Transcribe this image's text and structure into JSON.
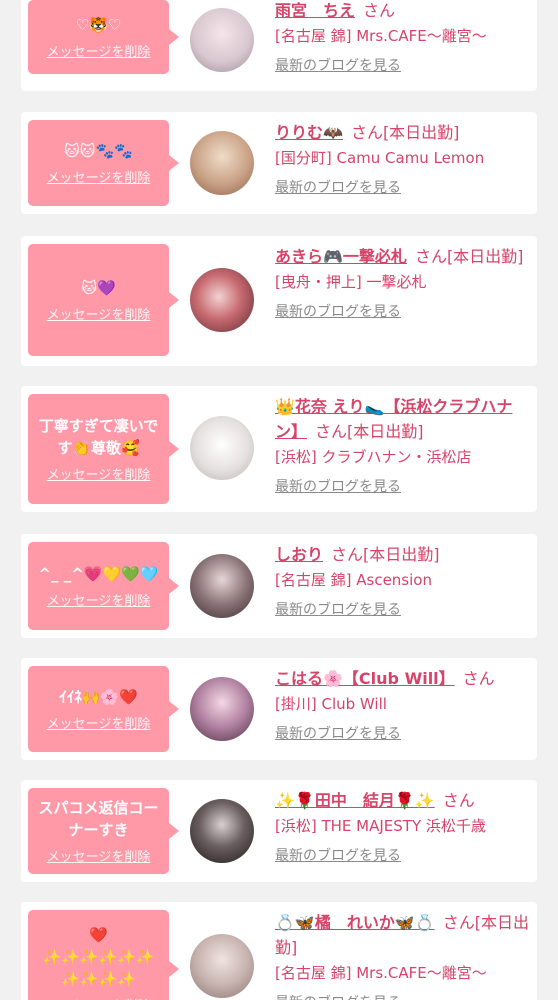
{
  "common": {
    "delete_label": "メッセージを削除",
    "blog_link": "最新のブログを見る",
    "san": "さん"
  },
  "colors": {
    "bubble": "#ff99a8",
    "accent": "#d8436a",
    "link_gray": "#8a8a8a",
    "background": "#f1f1f1"
  },
  "cards": [
    {
      "message": "♡🐯♡",
      "name": "雨宮　ちえ",
      "name_suffix": "さん",
      "shop": "[名古屋 錦] Mrs.CAFE〜離宮〜",
      "avatar_color": "#d9c8cf"
    },
    {
      "message": "🐱🐱🐾🐾",
      "name": "りりむ🦇",
      "name_suffix": "さん[本日出勤]",
      "shop": "[国分町] Camu Camu Lemon",
      "avatar_color": "#c9a185"
    },
    {
      "message": "🐱💜",
      "name": "あきら🎮一撃必札",
      "name_suffix": "さん[本日出勤]",
      "shop": "[曳舟・押上] 一撃必札",
      "avatar_color": "#8a4a50"
    },
    {
      "message": "丁寧すぎて凄いで\nす👏尊敬🥰",
      "name": "👑花奈 えり🥿【浜松クラブハナン】",
      "name_suffix": "さん[本日出勤]",
      "shop": "[浜松] クラブハナン・浜松店",
      "avatar_color": "#e4e0de"
    },
    {
      "message": "^_ _^💗💛💚🩵",
      "name": "しおり",
      "name_suffix": "さん[本日出勤]",
      "shop": "[名古屋 錦] Ascension",
      "avatar_color": "#5a4a4e"
    },
    {
      "message": "ｲｲﾈ🙌🌸❤️",
      "name": "こはる🌸【Club Will】",
      "name_suffix": "さん",
      "shop": "[掛川] Club Will",
      "avatar_color": "#7a5a68"
    },
    {
      "message": "スパコメ返信コー\nナーすき",
      "name": "✨🌹田中　結月🌹✨",
      "name_suffix": "さん",
      "shop": "[浜松] THE MAJESTY 浜松千歳",
      "avatar_color": "#3a3436"
    },
    {
      "message": "❤️\n✨✨✨✨✨✨\n✨✨✨✨",
      "name": "💍🦋橘　れいか🦋💍",
      "name_suffix": "さん[本日出勤]",
      "shop": "[名古屋 錦] Mrs.CAFE〜離宮〜",
      "avatar_color": "#c8b4b0"
    }
  ]
}
